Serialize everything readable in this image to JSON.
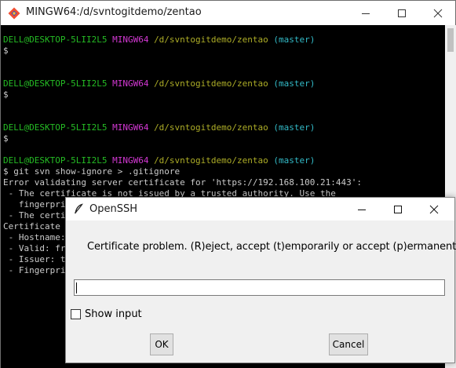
{
  "terminal": {
    "title": "MINGW64:/d/svntogitdemo/zentao",
    "lines": [
      {
        "type": "prompt",
        "user": "DELL@DESKTOP-5LII2L5",
        "shell": "MINGW64",
        "path": "/d/svntogitdemo/zentao",
        "branch": "(master)"
      },
      {
        "type": "text",
        "text": "$"
      },
      {
        "type": "blank",
        "text": ""
      },
      {
        "type": "blank",
        "text": ""
      },
      {
        "type": "prompt",
        "user": "DELL@DESKTOP-5LII2L5",
        "shell": "MINGW64",
        "path": "/d/svntogitdemo/zentao",
        "branch": "(master)"
      },
      {
        "type": "text",
        "text": "$"
      },
      {
        "type": "blank",
        "text": ""
      },
      {
        "type": "blank",
        "text": ""
      },
      {
        "type": "prompt",
        "user": "DELL@DESKTOP-5LII2L5",
        "shell": "MINGW64",
        "path": "/d/svntogitdemo/zentao",
        "branch": "(master)"
      },
      {
        "type": "text",
        "text": "$"
      },
      {
        "type": "blank",
        "text": ""
      },
      {
        "type": "prompt",
        "user": "DELL@DESKTOP-5LII2L5",
        "shell": "MINGW64",
        "path": "/d/svntogitdemo/zentao",
        "branch": "(master)"
      },
      {
        "type": "text",
        "text": "$ git svn show-ignore > .gitignore"
      },
      {
        "type": "text",
        "text": "Error validating server certificate for 'https://192.168.100.21:443':"
      },
      {
        "type": "text",
        "text": " - The certificate is not issued by a trusted authority. Use the"
      },
      {
        "type": "text",
        "text": "   fingerprint"
      },
      {
        "type": "text",
        "text": " - The certi"
      },
      {
        "type": "text",
        "text": "Certificate"
      },
      {
        "type": "text",
        "text": " - Hostname:"
      },
      {
        "type": "text",
        "text": " - Valid: fr"
      },
      {
        "type": "text",
        "text": " - Issuer: t"
      },
      {
        "type": "text",
        "text": " - Fingerpri"
      }
    ]
  },
  "dialog": {
    "title": "OpenSSH",
    "message": "Certificate problem. (R)eject, accept (t)emporarily or accept (p)ermanently?",
    "input_value": "",
    "checkbox_label": "Show input",
    "checkbox_checked": false,
    "ok_label": "OK",
    "cancel_label": "Cancel"
  },
  "icons": {
    "terminal_app": "git-bash-icon",
    "dialog_app": "feather-icon",
    "minimize": "minimize-icon",
    "maximize": "maximize-icon",
    "close": "close-icon"
  },
  "colors": {
    "user": "#25bc24",
    "shell": "#d338d3",
    "path": "#adad27",
    "branch": "#33bbc8"
  }
}
